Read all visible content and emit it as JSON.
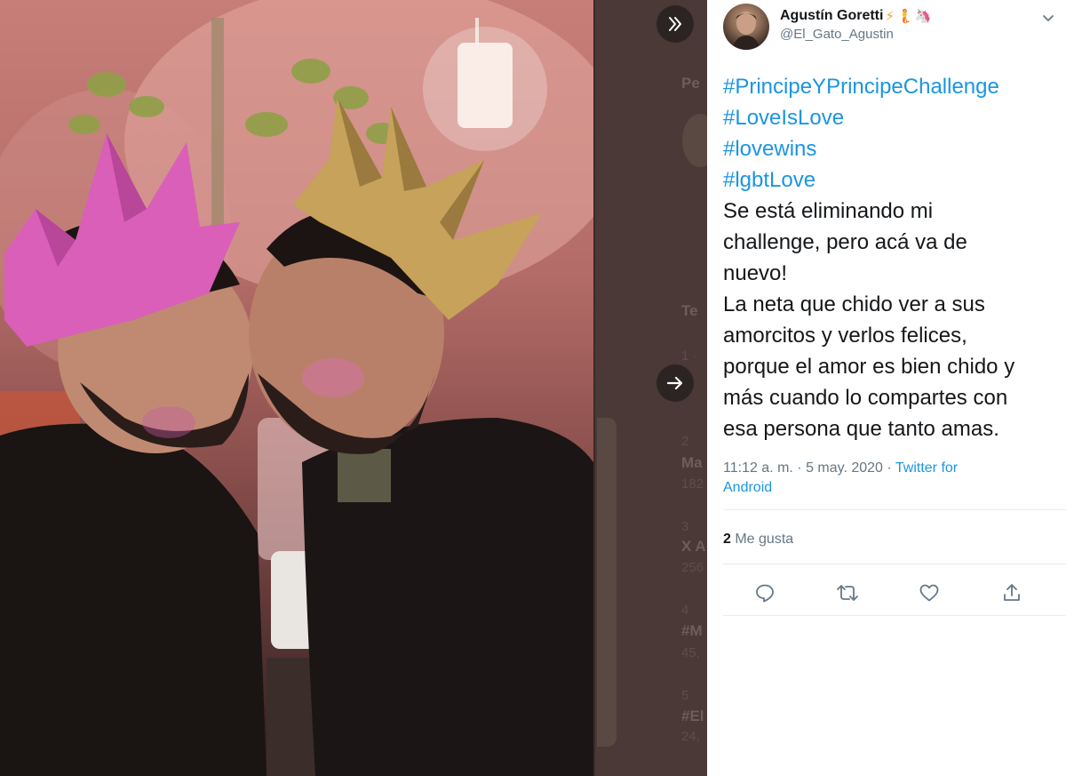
{
  "tweet": {
    "display_name": "Agustín Goretti",
    "name_emojis": [
      "⚡",
      "🧜",
      "🦄"
    ],
    "handle": "@El_Gato_Agustin",
    "hashtags": [
      "#PrincipeYPrincipeChallenge",
      "#LoveIsLove",
      "#lovewins",
      "#lgbtLove"
    ],
    "text_lines": [
      "Se está eliminando mi",
      "challenge, pero acá va de",
      "nuevo!",
      "La neta que chido ver a sus",
      "amorcitos y verlos felices,",
      "porque el amor es bien chido y",
      "más cuando lo compartes con",
      "esa persona que tanto amas."
    ],
    "time": "11:12 a. m.",
    "separator": " · ",
    "date": "5 may. 2020",
    "source_line1": "Twitter for",
    "source_line2": "Android",
    "likes_count": "2",
    "likes_label": " Me gusta"
  },
  "background_page": {
    "ghost_labels": [
      "Pe",
      "Te",
      "1 ·",
      "2",
      "Ma",
      "182",
      "3",
      "X A",
      "256",
      "4",
      "#M",
      "45,",
      "5",
      "#El",
      "24,"
    ]
  },
  "colors": {
    "link": "#1b95e0",
    "text": "#14171a",
    "muted": "#657786",
    "divider": "#e6ecf0"
  },
  "icons": {
    "collapse": "double-chevron-right-icon",
    "next": "arrow-right-icon",
    "more": "chevron-down-icon",
    "reply": "reply-icon",
    "retweet": "retweet-icon",
    "like": "heart-icon",
    "share": "share-icon"
  }
}
